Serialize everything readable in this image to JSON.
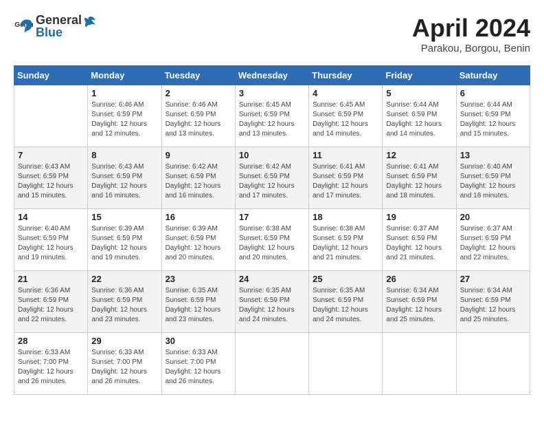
{
  "header": {
    "logo_general": "General",
    "logo_blue": "Blue",
    "month_title": "April 2024",
    "location": "Parakou, Borgou, Benin"
  },
  "days_of_week": [
    "Sunday",
    "Monday",
    "Tuesday",
    "Wednesday",
    "Thursday",
    "Friday",
    "Saturday"
  ],
  "weeks": [
    [
      {
        "day": "",
        "sunrise": "",
        "sunset": "",
        "daylight": ""
      },
      {
        "day": "1",
        "sunrise": "Sunrise: 6:46 AM",
        "sunset": "Sunset: 6:59 PM",
        "daylight": "Daylight: 12 hours and 12 minutes."
      },
      {
        "day": "2",
        "sunrise": "Sunrise: 6:46 AM",
        "sunset": "Sunset: 6:59 PM",
        "daylight": "Daylight: 12 hours and 13 minutes."
      },
      {
        "day": "3",
        "sunrise": "Sunrise: 6:45 AM",
        "sunset": "Sunset: 6:59 PM",
        "daylight": "Daylight: 12 hours and 13 minutes."
      },
      {
        "day": "4",
        "sunrise": "Sunrise: 6:45 AM",
        "sunset": "Sunset: 6:59 PM",
        "daylight": "Daylight: 12 hours and 14 minutes."
      },
      {
        "day": "5",
        "sunrise": "Sunrise: 6:44 AM",
        "sunset": "Sunset: 6:59 PM",
        "daylight": "Daylight: 12 hours and 14 minutes."
      },
      {
        "day": "6",
        "sunrise": "Sunrise: 6:44 AM",
        "sunset": "Sunset: 6:59 PM",
        "daylight": "Daylight: 12 hours and 15 minutes."
      }
    ],
    [
      {
        "day": "7",
        "sunrise": "Sunrise: 6:43 AM",
        "sunset": "Sunset: 6:59 PM",
        "daylight": "Daylight: 12 hours and 15 minutes."
      },
      {
        "day": "8",
        "sunrise": "Sunrise: 6:43 AM",
        "sunset": "Sunset: 6:59 PM",
        "daylight": "Daylight: 12 hours and 16 minutes."
      },
      {
        "day": "9",
        "sunrise": "Sunrise: 6:42 AM",
        "sunset": "Sunset: 6:59 PM",
        "daylight": "Daylight: 12 hours and 16 minutes."
      },
      {
        "day": "10",
        "sunrise": "Sunrise: 6:42 AM",
        "sunset": "Sunset: 6:59 PM",
        "daylight": "Daylight: 12 hours and 17 minutes."
      },
      {
        "day": "11",
        "sunrise": "Sunrise: 6:41 AM",
        "sunset": "Sunset: 6:59 PM",
        "daylight": "Daylight: 12 hours and 17 minutes."
      },
      {
        "day": "12",
        "sunrise": "Sunrise: 6:41 AM",
        "sunset": "Sunset: 6:59 PM",
        "daylight": "Daylight: 12 hours and 18 minutes."
      },
      {
        "day": "13",
        "sunrise": "Sunrise: 6:40 AM",
        "sunset": "Sunset: 6:59 PM",
        "daylight": "Daylight: 12 hours and 18 minutes."
      }
    ],
    [
      {
        "day": "14",
        "sunrise": "Sunrise: 6:40 AM",
        "sunset": "Sunset: 6:59 PM",
        "daylight": "Daylight: 12 hours and 19 minutes."
      },
      {
        "day": "15",
        "sunrise": "Sunrise: 6:39 AM",
        "sunset": "Sunset: 6:59 PM",
        "daylight": "Daylight: 12 hours and 19 minutes."
      },
      {
        "day": "16",
        "sunrise": "Sunrise: 6:39 AM",
        "sunset": "Sunset: 6:59 PM",
        "daylight": "Daylight: 12 hours and 20 minutes."
      },
      {
        "day": "17",
        "sunrise": "Sunrise: 6:38 AM",
        "sunset": "Sunset: 6:59 PM",
        "daylight": "Daylight: 12 hours and 20 minutes."
      },
      {
        "day": "18",
        "sunrise": "Sunrise: 6:38 AM",
        "sunset": "Sunset: 6:59 PM",
        "daylight": "Daylight: 12 hours and 21 minutes."
      },
      {
        "day": "19",
        "sunrise": "Sunrise: 6:37 AM",
        "sunset": "Sunset: 6:59 PM",
        "daylight": "Daylight: 12 hours and 21 minutes."
      },
      {
        "day": "20",
        "sunrise": "Sunrise: 6:37 AM",
        "sunset": "Sunset: 6:59 PM",
        "daylight": "Daylight: 12 hours and 22 minutes."
      }
    ],
    [
      {
        "day": "21",
        "sunrise": "Sunrise: 6:36 AM",
        "sunset": "Sunset: 6:59 PM",
        "daylight": "Daylight: 12 hours and 22 minutes."
      },
      {
        "day": "22",
        "sunrise": "Sunrise: 6:36 AM",
        "sunset": "Sunset: 6:59 PM",
        "daylight": "Daylight: 12 hours and 23 minutes."
      },
      {
        "day": "23",
        "sunrise": "Sunrise: 6:35 AM",
        "sunset": "Sunset: 6:59 PM",
        "daylight": "Daylight: 12 hours and 23 minutes."
      },
      {
        "day": "24",
        "sunrise": "Sunrise: 6:35 AM",
        "sunset": "Sunset: 6:59 PM",
        "daylight": "Daylight: 12 hours and 24 minutes."
      },
      {
        "day": "25",
        "sunrise": "Sunrise: 6:35 AM",
        "sunset": "Sunset: 6:59 PM",
        "daylight": "Daylight: 12 hours and 24 minutes."
      },
      {
        "day": "26",
        "sunrise": "Sunrise: 6:34 AM",
        "sunset": "Sunset: 6:59 PM",
        "daylight": "Daylight: 12 hours and 25 minutes."
      },
      {
        "day": "27",
        "sunrise": "Sunrise: 6:34 AM",
        "sunset": "Sunset: 6:59 PM",
        "daylight": "Daylight: 12 hours and 25 minutes."
      }
    ],
    [
      {
        "day": "28",
        "sunrise": "Sunrise: 6:33 AM",
        "sunset": "Sunset: 7:00 PM",
        "daylight": "Daylight: 12 hours and 26 minutes."
      },
      {
        "day": "29",
        "sunrise": "Sunrise: 6:33 AM",
        "sunset": "Sunset: 7:00 PM",
        "daylight": "Daylight: 12 hours and 26 minutes."
      },
      {
        "day": "30",
        "sunrise": "Sunrise: 6:33 AM",
        "sunset": "Sunset: 7:00 PM",
        "daylight": "Daylight: 12 hours and 26 minutes."
      },
      {
        "day": "",
        "sunrise": "",
        "sunset": "",
        "daylight": ""
      },
      {
        "day": "",
        "sunrise": "",
        "sunset": "",
        "daylight": ""
      },
      {
        "day": "",
        "sunrise": "",
        "sunset": "",
        "daylight": ""
      },
      {
        "day": "",
        "sunrise": "",
        "sunset": "",
        "daylight": ""
      }
    ]
  ]
}
